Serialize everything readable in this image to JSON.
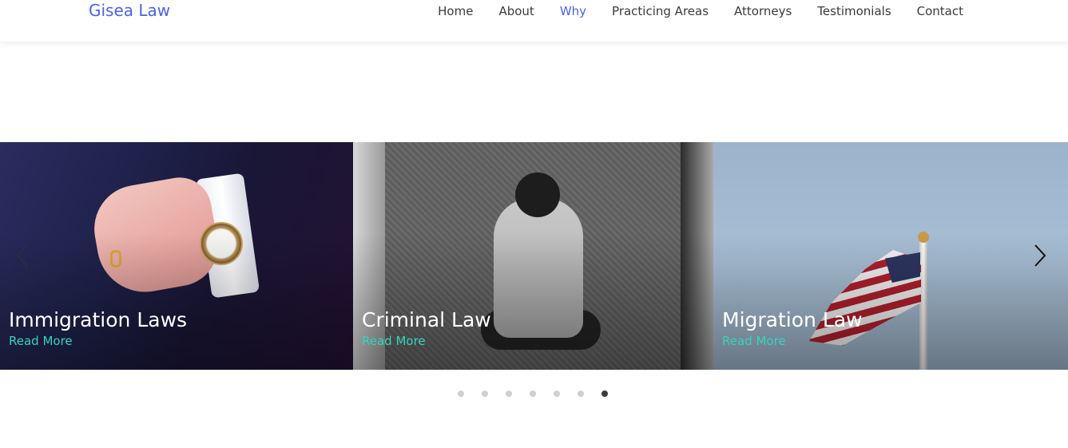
{
  "header": {
    "brand": "Gisea Law",
    "nav": [
      {
        "label": "Home",
        "active": false
      },
      {
        "label": "About",
        "active": false
      },
      {
        "label": "Why",
        "active": true
      },
      {
        "label": "Practicing Areas",
        "active": false
      },
      {
        "label": "Attorneys",
        "active": false
      },
      {
        "label": "Testimonials",
        "active": false
      },
      {
        "label": "Contact",
        "active": false
      }
    ]
  },
  "carousel": {
    "slides": [
      {
        "title": "Immigration Laws",
        "link": "Read More",
        "image": "suit-watch-photo"
      },
      {
        "title": "Criminal Law",
        "link": "Read More",
        "image": "person-on-stairs-photo"
      },
      {
        "title": "Migration Law",
        "link": "Read More",
        "image": "us-flag-photo"
      }
    ],
    "dot_count": 7,
    "active_dot": 7
  },
  "colors": {
    "accent": "#4a63e7",
    "link": "#34d5c0",
    "text": "#3b3b3b"
  }
}
